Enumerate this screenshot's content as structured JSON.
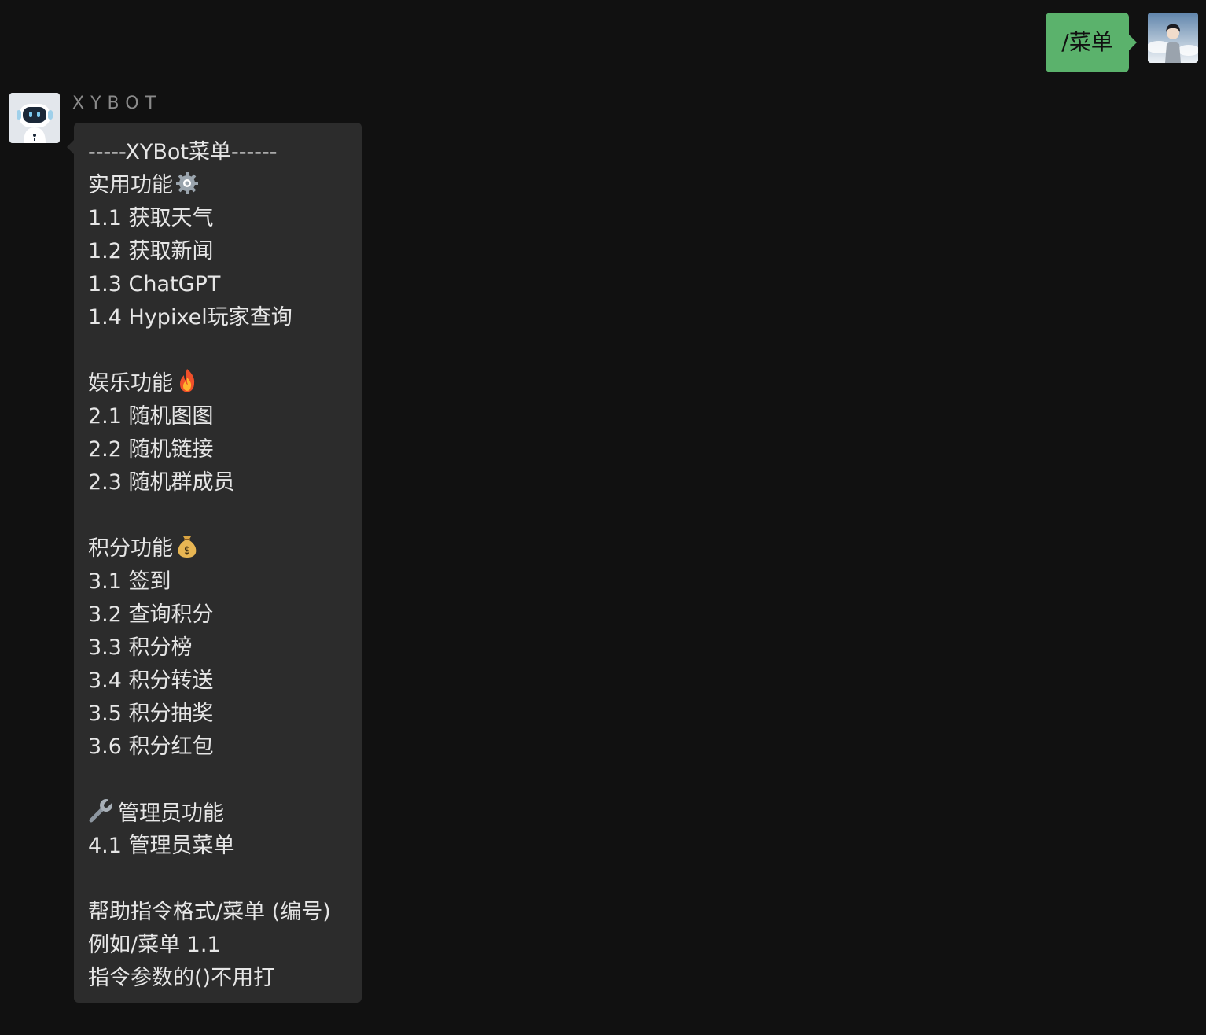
{
  "outgoing": {
    "text": "/菜单"
  },
  "incoming": {
    "sender": "XYBOT",
    "lines": [
      "-----XYBot菜单------",
      "实用功能",
      "1.1 获取天气",
      "1.2 获取新闻",
      "1.3 ChatGPT",
      "1.4 Hypixel玩家查询",
      "",
      "娱乐功能",
      "2.1 随机图图",
      "2.2 随机链接",
      "2.3 随机群成员",
      "",
      "积分功能",
      "3.1 签到",
      "3.2 查询积分",
      "3.3 积分榜",
      "3.4 积分转送",
      "3.5 积分抽奖",
      "3.6 积分红包",
      "",
      "管理员功能",
      "4.1 管理员菜单",
      "",
      "帮助指令格式/菜单 (编号)",
      "例如/菜单 1.1",
      "指令参数的()不用打"
    ],
    "icons": {
      "practical": "gear-icon",
      "entertainment": "fire-icon",
      "points": "money-bag-icon",
      "admin": "wrench-icon"
    }
  },
  "colors": {
    "background": "#111111",
    "outgoing_bubble": "#5bb26c",
    "incoming_bubble": "#2c2c2c",
    "text": "#e6e6e6",
    "sender_name": "#8a8a8a"
  }
}
